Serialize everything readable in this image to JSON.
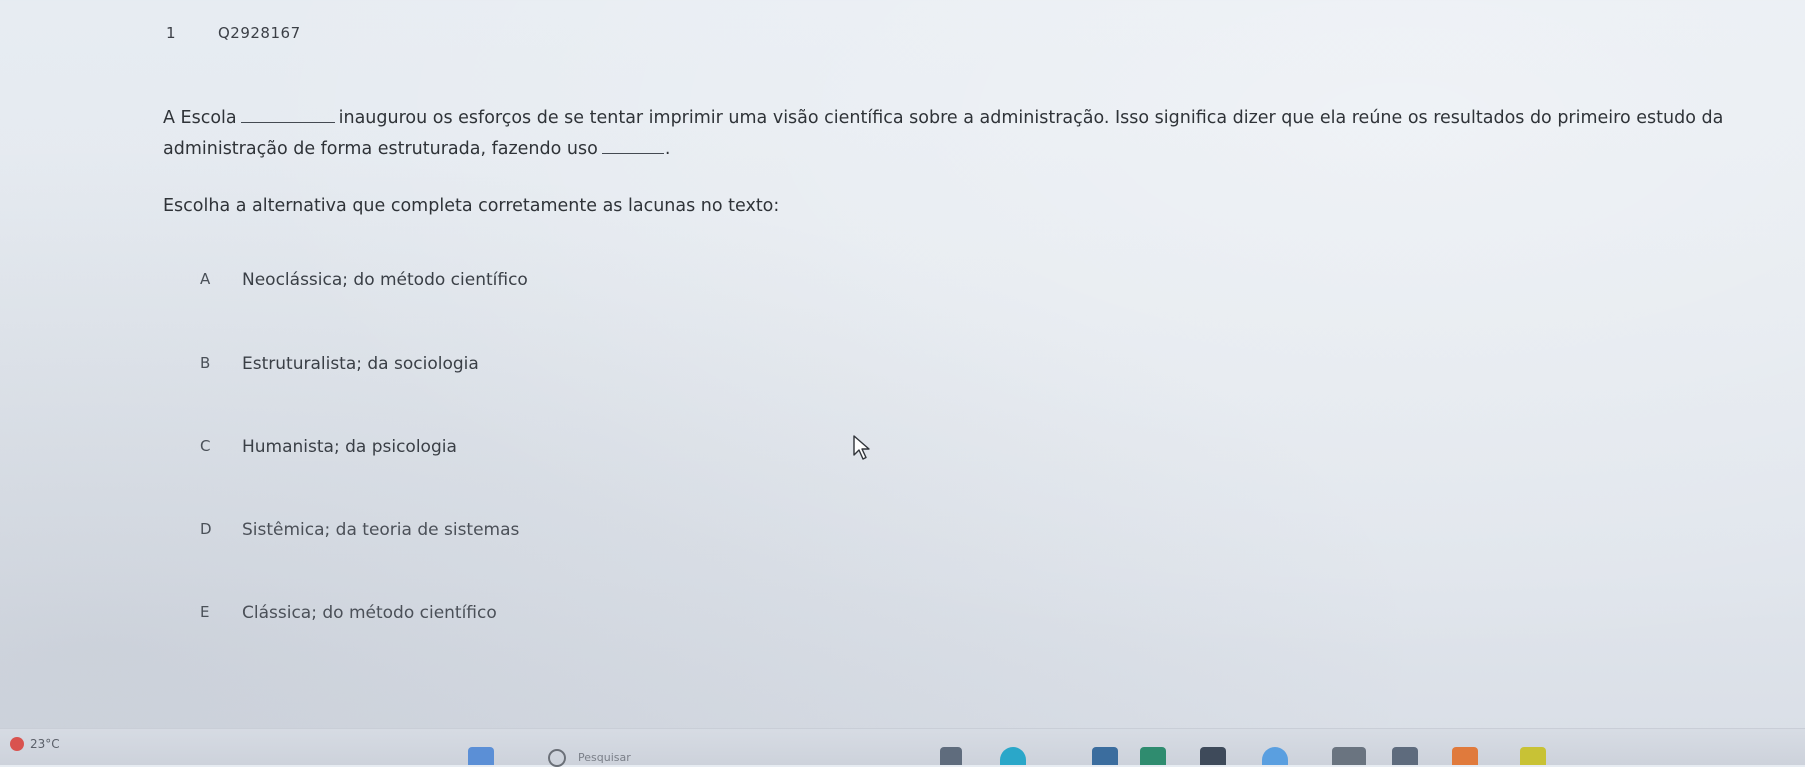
{
  "question": {
    "number": "1",
    "code": "Q2928167",
    "statement_parts": [
      "A Escola",
      "inaugurou os esforços de se tentar imprimir uma visão científica sobre a administração. Isso significa dizer que ela reúne os resultados do primeiro estudo da administração de forma estruturada, fazendo uso",
      "."
    ],
    "instruction": "Escolha a alternativa que completa corretamente as lacunas no texto:"
  },
  "options": [
    {
      "letter": "A",
      "text": "Neoclássica; do método científico"
    },
    {
      "letter": "B",
      "text": "Estruturalista; da sociologia"
    },
    {
      "letter": "C",
      "text": "Humanista; da psicologia"
    },
    {
      "letter": "D",
      "text": "Sistêmica; da teoria de sistemas"
    },
    {
      "letter": "E",
      "text": "Clássica; do método científico"
    }
  ],
  "taskbar": {
    "weather_temp": "23°C",
    "weather_icon": "weather-icon",
    "search_icon": "search-icon",
    "search_label": "Pesquisar"
  }
}
